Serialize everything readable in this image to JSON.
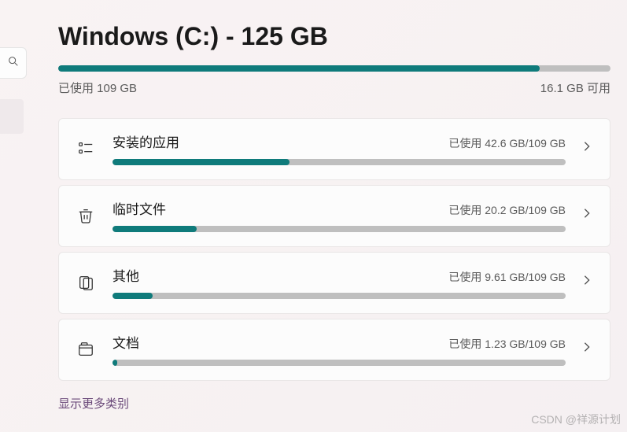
{
  "header": {
    "title": "Windows (C:) - 125 GB",
    "used_label": "已使用 109 GB",
    "free_label": "16.1 GB 可用",
    "used_percent": 87.2
  },
  "categories": [
    {
      "icon": "apps-icon",
      "title": "安装的应用",
      "usage": "已使用 42.6 GB/109 GB",
      "percent": 39.1
    },
    {
      "icon": "trash-icon",
      "title": "临时文件",
      "usage": "已使用 20.2 GB/109 GB",
      "percent": 18.5
    },
    {
      "icon": "other-icon",
      "title": "其他",
      "usage": "已使用 9.61 GB/109 GB",
      "percent": 8.8
    },
    {
      "icon": "documents-icon",
      "title": "文档",
      "usage": "已使用 1.23 GB/109 GB",
      "percent": 1.1
    }
  ],
  "more_link": "显示更多类别",
  "watermark": "CSDN @祥源计划",
  "colors": {
    "accent": "#0f7b7b",
    "bar_bg": "#bfbfbf"
  }
}
